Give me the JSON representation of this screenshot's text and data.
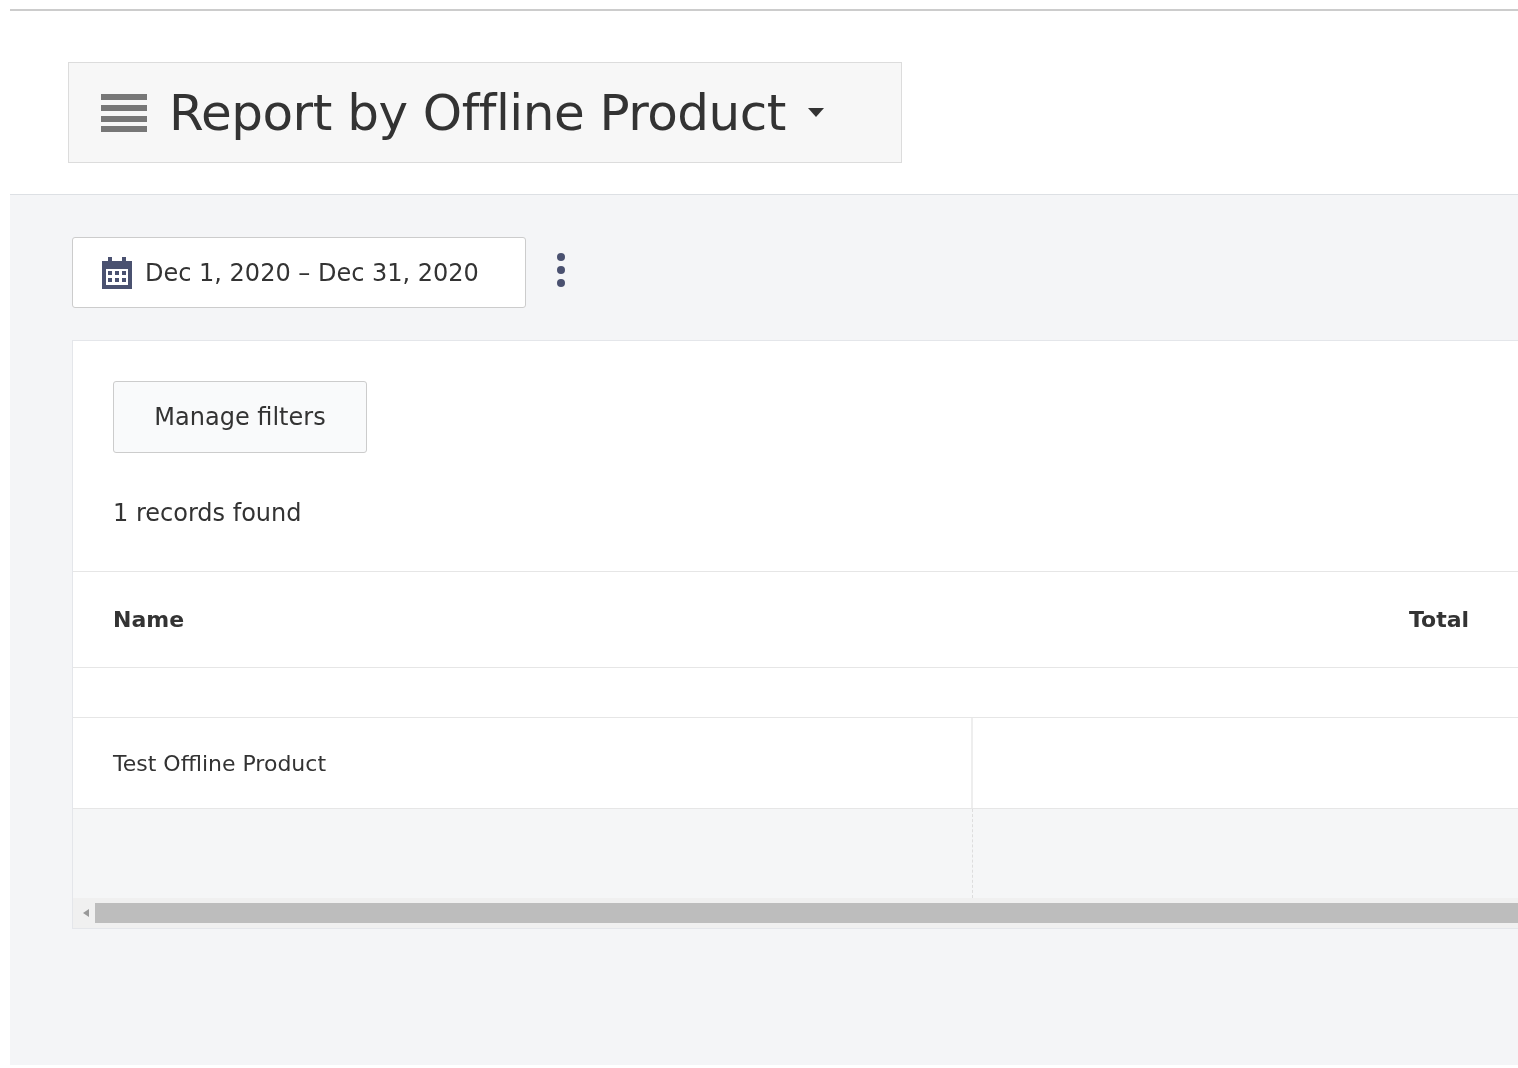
{
  "header": {
    "title": "Report by Offline Product"
  },
  "toolbar": {
    "date_range": "Dec 1, 2020 – Dec 31, 2020"
  },
  "card": {
    "manage_filters_button": "Manage filters",
    "records_count": "1 records found",
    "table": {
      "columns": [
        "Name",
        "Total"
      ],
      "rows": [
        {
          "name": "Test Offline Product"
        }
      ]
    }
  }
}
